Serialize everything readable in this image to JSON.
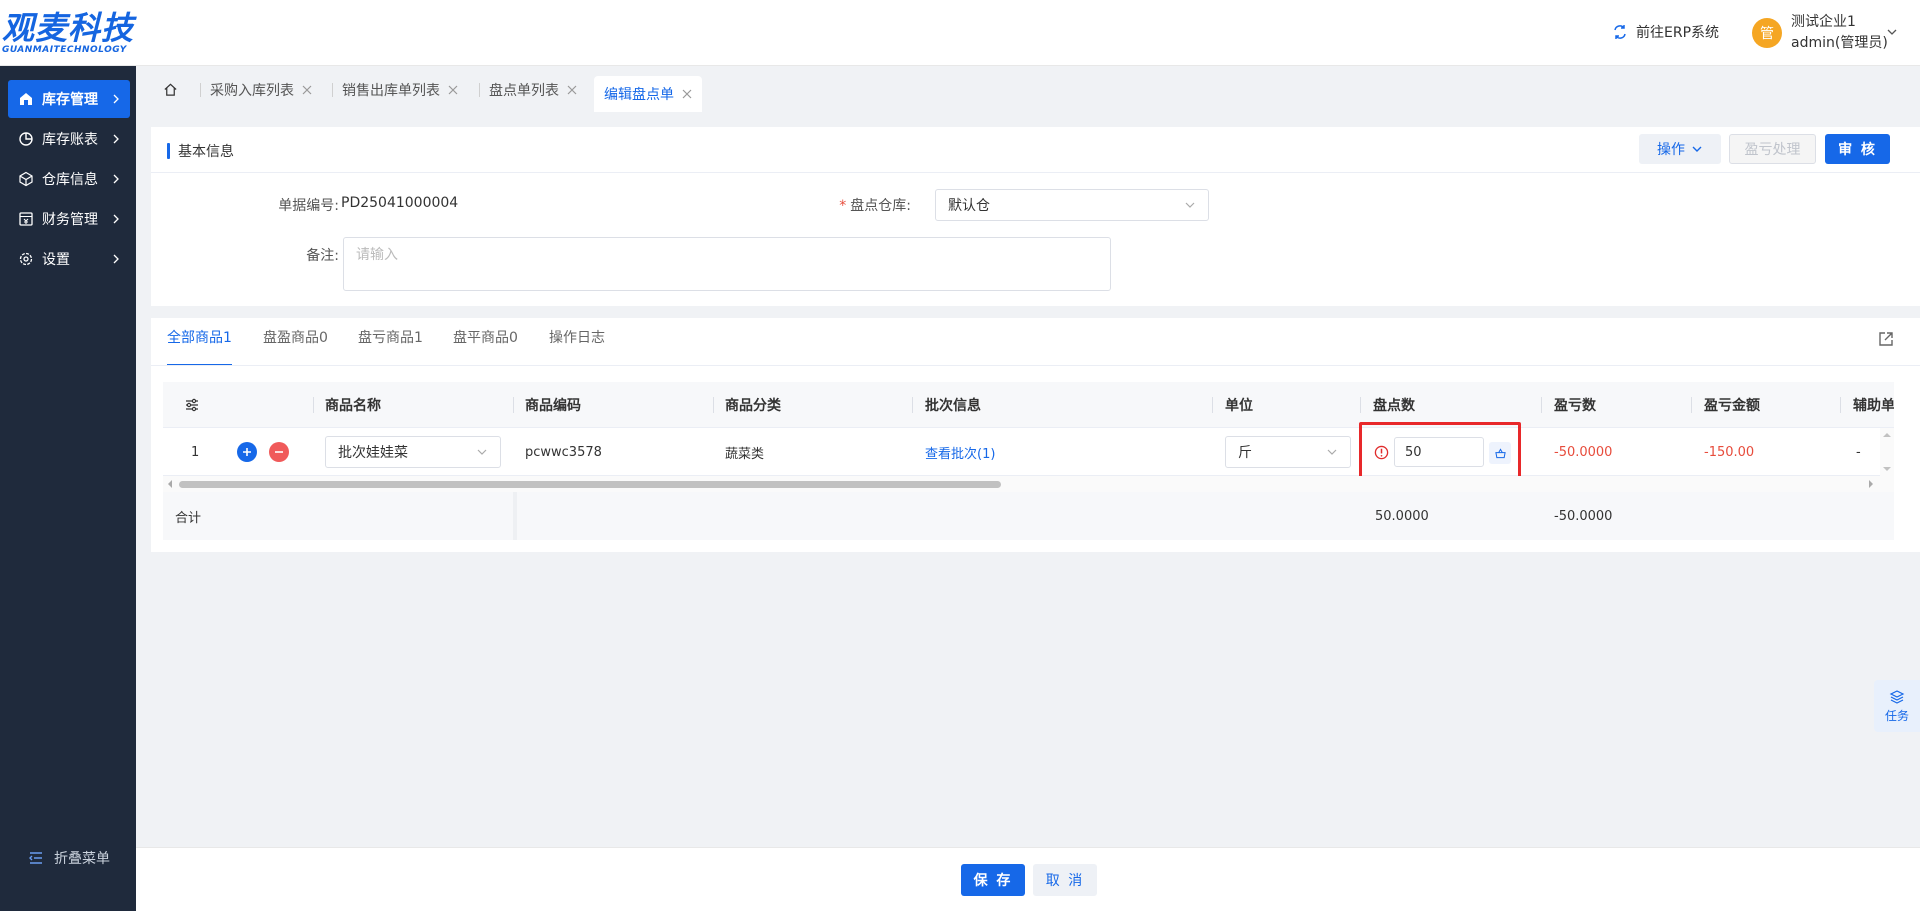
{
  "brand": {
    "logo_cn": "观麦科技",
    "logo_en": "GUANMAITECHNOLOGY",
    "color": "#1668e8"
  },
  "header": {
    "erp_link": "前往ERP系统",
    "avatar_text": "管",
    "company": "测试企业1",
    "user": "admin(管理员)"
  },
  "sidebar": {
    "items": [
      {
        "label": "库存管理",
        "icon": "warehouse-icon",
        "active": true
      },
      {
        "label": "库存账表",
        "icon": "pie-chart-icon"
      },
      {
        "label": "仓库信息",
        "icon": "cube-icon"
      },
      {
        "label": "财务管理",
        "icon": "finance-icon"
      },
      {
        "label": "设置",
        "icon": "gear-icon"
      }
    ],
    "collapse_label": "折叠菜单"
  },
  "page_tabs": [
    {
      "label": "采购入库列表"
    },
    {
      "label": "销售出库单列表"
    },
    {
      "label": "盘点单列表"
    },
    {
      "label": "编辑盘点单",
      "active": true
    }
  ],
  "basic_info": {
    "title": "基本信息",
    "actions": {
      "operate": "操作",
      "pl_process": "盈亏处理",
      "audit": "审 核"
    },
    "fields": {
      "doc_no_label": "单据编号:",
      "doc_no_value": "PD25041000004",
      "warehouse_label": "盘点仓库:",
      "warehouse_value": "默认仓",
      "remark_label": "备注:",
      "remark_placeholder": "请输入"
    }
  },
  "goods_tabs": [
    {
      "label": "全部商品1",
      "active": true
    },
    {
      "label": "盘盈商品0"
    },
    {
      "label": "盘亏商品1"
    },
    {
      "label": "盘平商品0"
    },
    {
      "label": "操作日志"
    }
  ],
  "table": {
    "columns": [
      "商品名称",
      "商品编码",
      "商品分类",
      "批次信息",
      "单位",
      "盘点数",
      "盈亏数",
      "盈亏金额",
      "辅助单"
    ],
    "rows": [
      {
        "index": "1",
        "name": "批次娃娃菜",
        "code": "pcwwc3578",
        "category": "蔬菜类",
        "batch": "查看批次(1)",
        "unit": "斤",
        "count": "50",
        "pl_qty": "-50.0000",
        "pl_amount": "-150.00",
        "aux": "-"
      }
    ],
    "footer": {
      "label": "合计",
      "count_total": "50.0000",
      "pl_total": "-50.0000"
    }
  },
  "task_float": {
    "label": "任务"
  },
  "bottom": {
    "save": "保 存",
    "cancel": "取 消"
  }
}
